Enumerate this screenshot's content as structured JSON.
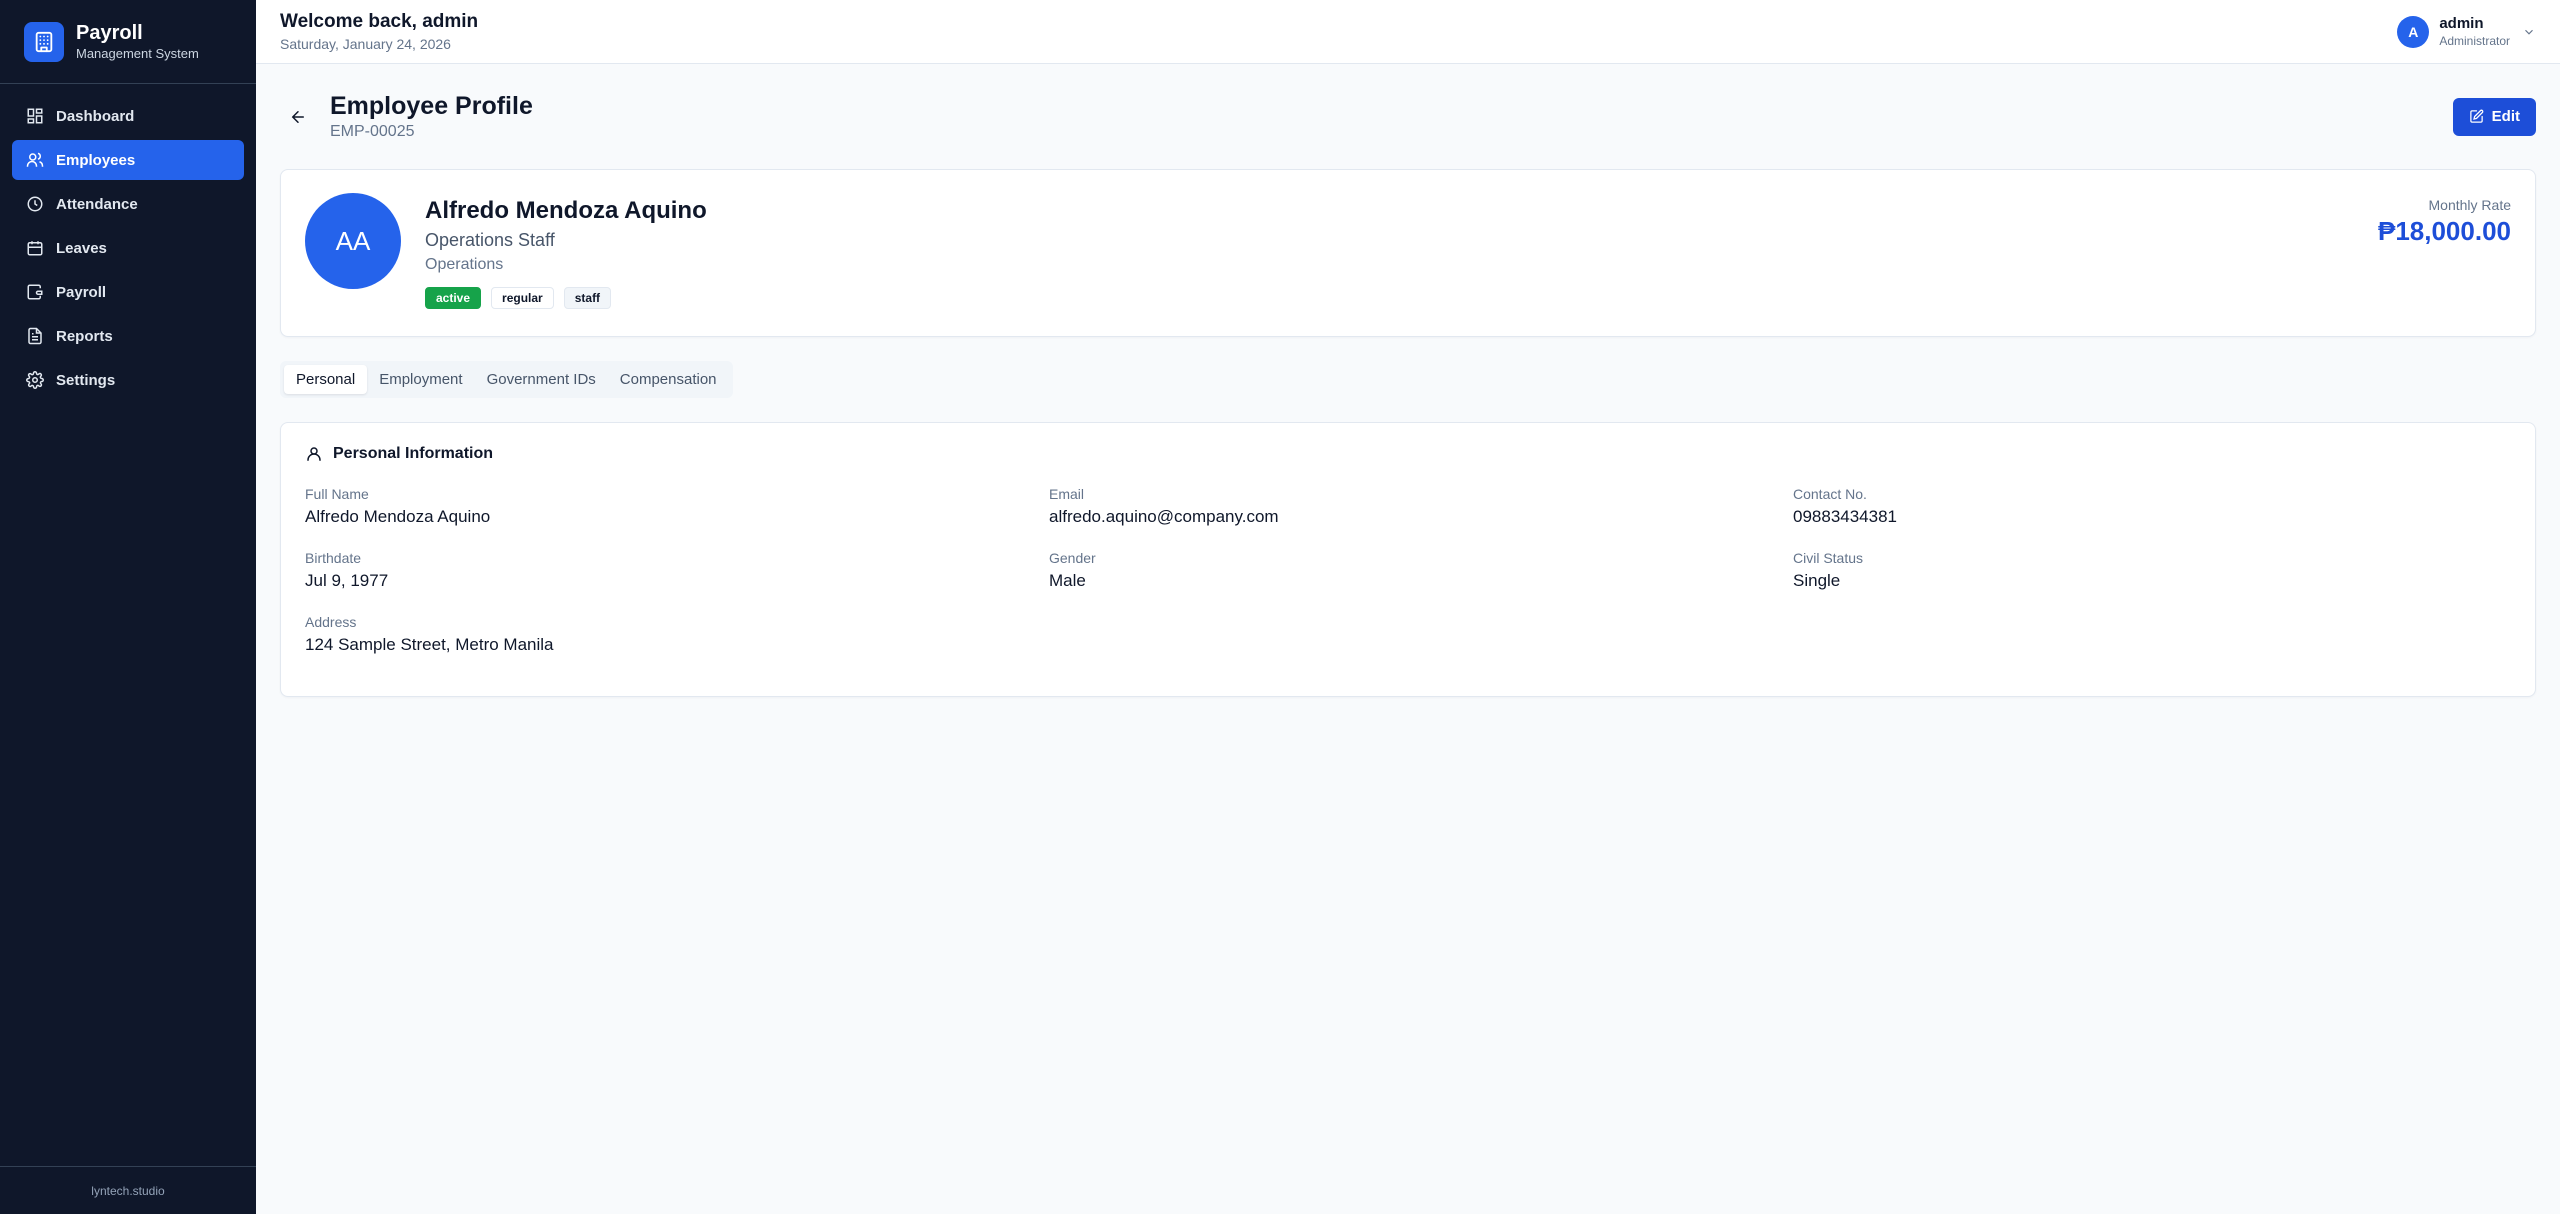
{
  "brand": {
    "title": "Payroll",
    "subtitle": "Management System"
  },
  "nav": [
    {
      "label": "Dashboard",
      "icon": "dashboard-icon"
    },
    {
      "label": "Employees",
      "icon": "users-icon"
    },
    {
      "label": "Attendance",
      "icon": "clock-icon"
    },
    {
      "label": "Leaves",
      "icon": "calendar-icon"
    },
    {
      "label": "Payroll",
      "icon": "wallet-icon"
    },
    {
      "label": "Reports",
      "icon": "file-text-icon"
    },
    {
      "label": "Settings",
      "icon": "gear-icon"
    }
  ],
  "active_nav": "Employees",
  "footer": {
    "text": "lyntech.studio"
  },
  "header": {
    "welcome": "Welcome back, admin",
    "date": "Saturday, January 24, 2026"
  },
  "user": {
    "initial": "A",
    "name": "admin",
    "role": "Administrator"
  },
  "page": {
    "title": "Employee Profile",
    "employee_id": "EMP-00025",
    "edit_label": "Edit"
  },
  "profile": {
    "initials": "AA",
    "name": "Alfredo Mendoza Aquino",
    "position": "Operations Staff",
    "department": "Operations",
    "badges": [
      "active",
      "regular",
      "staff"
    ],
    "rate_label": "Monthly Rate",
    "rate_value": "₱18,000.00"
  },
  "tabs": [
    "Personal",
    "Employment",
    "Government IDs",
    "Compensation"
  ],
  "active_tab": "Personal",
  "personal": {
    "heading": "Personal Information",
    "full_name_label": "Full Name",
    "full_name": "Alfredo Mendoza Aquino",
    "email_label": "Email",
    "email": "alfredo.aquino@company.com",
    "contact_label": "Contact No.",
    "contact": "09883434381",
    "birthdate_label": "Birthdate",
    "birthdate": "Jul 9, 1977",
    "gender_label": "Gender",
    "gender": "Male",
    "civil_label": "Civil Status",
    "civil": "Single",
    "address_label": "Address",
    "address": "124 Sample Street, Metro Manila"
  },
  "colors": {
    "sidebar": "#0f172a",
    "accent": "#2563eb",
    "active_badge": "#16a34a",
    "rate": "#1d4ed8"
  }
}
